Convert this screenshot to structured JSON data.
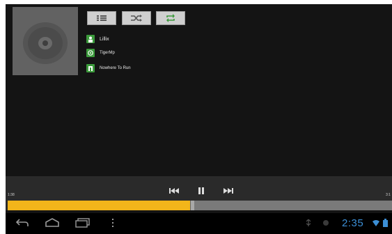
{
  "player": {
    "album_art_icon": "cd-disc-icon",
    "toolbar": [
      {
        "name": "playlist-button",
        "icon": "list-icon"
      },
      {
        "name": "shuffle-button",
        "icon": "shuffle-icon"
      },
      {
        "name": "repeat-button",
        "icon": "repeat-icon"
      }
    ],
    "track": {
      "title": "Lillix",
      "artist": "TigerMp",
      "album": "Nowhere To Run"
    },
    "time_elapsed": "1:38",
    "time_total": "3:1",
    "progress": 0.475,
    "controls": [
      "previous-icon",
      "pause-icon",
      "next-icon"
    ]
  },
  "status_bar": {
    "clock": "2:35"
  },
  "colors": {
    "accent": "#f2b51a",
    "icon_green": "#3b9a3b",
    "clock_blue": "#3c8fd6"
  }
}
